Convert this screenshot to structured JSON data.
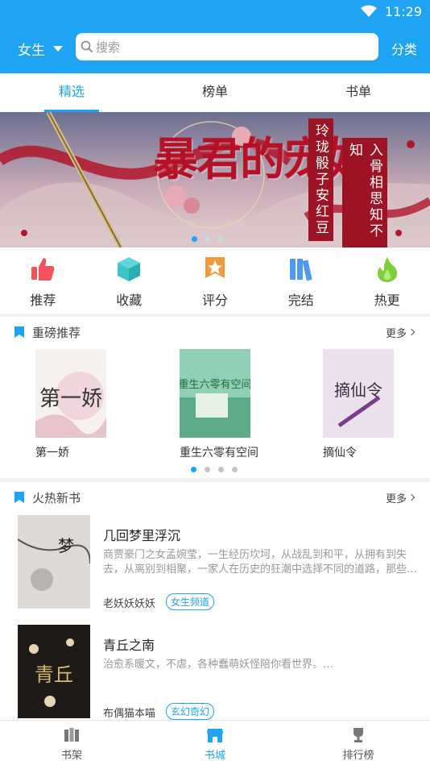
{
  "status": {
    "time": "11:29"
  },
  "header": {
    "gender_label": "女生",
    "search_placeholder": "搜索",
    "category_label": "分类"
  },
  "tabs": [
    {
      "label": "精选",
      "active": true
    },
    {
      "label": "榜单",
      "active": false
    },
    {
      "label": "书单",
      "active": false
    }
  ],
  "banner": {
    "title": "暴君的宠姬",
    "line1": "玲珑骰子安红豆",
    "line2": "入骨相思知不知",
    "page_count": 3,
    "active_page": 1
  },
  "quick_nav": [
    {
      "label": "推荐",
      "icon": "thumbs-up-icon",
      "color": "#f4525a"
    },
    {
      "label": "收藏",
      "icon": "cube-icon",
      "color": "#3cc4c9"
    },
    {
      "label": "评分",
      "icon": "star-ribbon-icon",
      "color": "#f59a3b"
    },
    {
      "label": "完结",
      "icon": "books-icon",
      "color": "#4c9bf0"
    },
    {
      "label": "热更",
      "icon": "flame-icon",
      "color": "#7ccf3b"
    }
  ],
  "featured": {
    "title": "重磅推荐",
    "more_label": "更多",
    "books": [
      {
        "title": "第一娇",
        "cover_text": "第一娇"
      },
      {
        "title": "重生六零有空间",
        "cover_text": "重生六零有空间"
      },
      {
        "title": "摘仙令",
        "cover_text": "摘仙令"
      }
    ],
    "page_count": 4,
    "active_page": 1
  },
  "hot": {
    "title": "火热新书",
    "more_label": "更多",
    "books": [
      {
        "title": "几回梦里浮沉",
        "description": "商贾豪门之女孟婉莹，一生经历坎坷，从战乱到和平，从拥有到失去，从离别到相聚，一家人在历史的狂潮中选择不同的道路，那些…",
        "author": "老妖妖妖妖",
        "tag": "女生频道"
      },
      {
        "title": "青丘之南",
        "description": "治愈系暖文，不虐，各种蠢萌妖怪陪你看世界。…",
        "author": "布偶猫本喵",
        "tag": "玄幻奇幻"
      }
    ]
  },
  "bottom_nav": [
    {
      "label": "书架",
      "active": false
    },
    {
      "label": "书城",
      "active": true
    },
    {
      "label": "排行榜",
      "active": false
    }
  ],
  "colors": {
    "primary": "#1ea4f2"
  }
}
